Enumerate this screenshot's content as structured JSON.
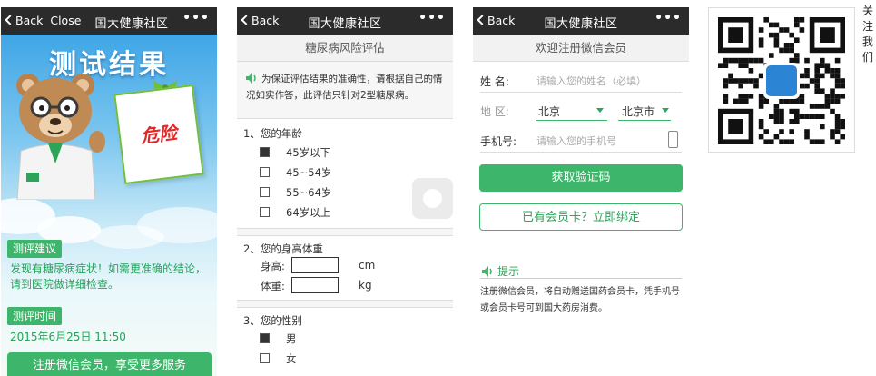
{
  "screen1": {
    "back_label": "Back",
    "close_label": "Close",
    "title": "国大健康社区",
    "more": "•••",
    "heading": "测试结果",
    "risk_label": "危险",
    "advice_tag": "测评建议",
    "advice_text": "发现有糖尿病症状！如需更准确的结论，请到医院做详细检查。",
    "time_tag": "测评时间",
    "time_value": "2015年6月25日 11:50",
    "register_button": "注册微信会员，享受更多服务"
  },
  "screen2": {
    "back_label": "Back",
    "title": "国大健康社区",
    "more": "•••",
    "subtitle": "糖尿病风险评估",
    "notice": "为保证评估结果的准确性，请根据自己的情况如实作答，此评估只针对2型糖尿病。",
    "q1": {
      "title": "1、您的年龄",
      "options": [
        "45岁以下",
        "45~54岁",
        "55~64岁",
        "64岁以上"
      ],
      "selected": 0
    },
    "q2": {
      "title": "2、您的身高体重",
      "height_label": "身高:",
      "height_unit": "cm",
      "weight_label": "体重:",
      "weight_unit": "kg"
    },
    "q3": {
      "title": "3、您的性别",
      "options": [
        "男",
        "女"
      ],
      "selected": 0
    }
  },
  "screen3": {
    "back_label": "Back",
    "title": "国大健康社区",
    "more": "•••",
    "subtitle": "欢迎注册微信会员",
    "name_label": "姓  名:",
    "name_placeholder": "请输入您的姓名（必填）",
    "region_label": "地  区:",
    "province": "北京",
    "city": "北京市",
    "phone_label": "手机号:",
    "phone_placeholder": "请输入您的手机号",
    "get_code_button": "获取验证码",
    "bind_card_button": "已有会员卡？立即绑定",
    "tip_label": "提示",
    "tip_text": "注册微信会员，将自动赠送国药会员卡，凭手机号或会员卡号可到国大药房消费。"
  },
  "follow_text": "关注我们",
  "colors": {
    "green": "#3db56a",
    "topbar": "#2b2b2b",
    "danger": "#e02a2a",
    "sky": "#3fa6e6"
  }
}
